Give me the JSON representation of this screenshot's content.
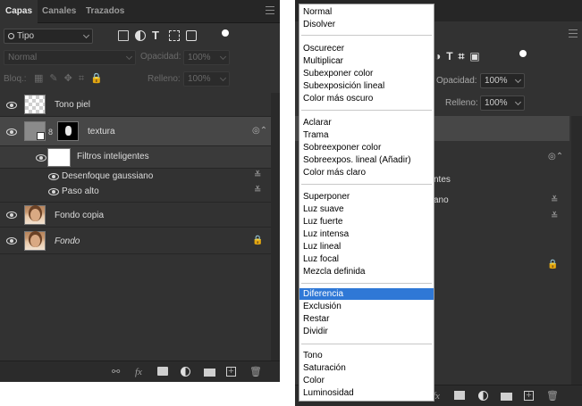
{
  "left_panel": {
    "tabs": [
      "Capas",
      "Canales",
      "Trazados"
    ],
    "filter": {
      "kind_label": "Tipo"
    },
    "blend": {
      "value": "Normal",
      "opacity_label": "Opacidad:",
      "opacity_value": "100%"
    },
    "lock": {
      "label": "Bloq.:",
      "fill_label": "Relleno:",
      "fill_value": "100%"
    },
    "layers": [
      {
        "name": "Tono piel",
        "thumb": "transparent"
      },
      {
        "name": "textura",
        "thumb": "smart-object"
      },
      {
        "name": "Filtros inteligentes"
      },
      {
        "name": "Desenfoque gaussiano"
      },
      {
        "name": "Paso alto"
      },
      {
        "name": "Fondo copia",
        "thumb": "portrait"
      },
      {
        "name": "Fondo",
        "thumb": "portrait",
        "locked": true
      }
    ]
  },
  "right_panel": {
    "opacity_label": "Opacidad:",
    "opacity_value": "100%",
    "fill_label": "Relleno:",
    "fill_value": "100%",
    "fragments": [
      "ntes",
      "ano"
    ]
  },
  "blend_menu": {
    "selected": "Diferencia",
    "groups": [
      [
        "Normal",
        "Disolver"
      ],
      [
        "Oscurecer",
        "Multiplicar",
        "Subexponer color",
        "Subexposición lineal",
        "Color más oscuro"
      ],
      [
        "Aclarar",
        "Trama",
        "Sobreexponer color",
        "Sobreexpos. lineal (Añadir)",
        "Color más claro"
      ],
      [
        "Superponer",
        "Luz suave",
        "Luz fuerte",
        "Luz intensa",
        "Luz lineal",
        "Luz focal",
        "Mezcla definida"
      ],
      [
        "Diferencia",
        "Exclusión",
        "Restar",
        "Dividir"
      ],
      [
        "Tono",
        "Saturación",
        "Color",
        "Luminosidad"
      ]
    ]
  },
  "colors": {
    "panel_bg": "#323232",
    "selected_layer": "#474747",
    "menu_highlight": "#2f78d6"
  }
}
